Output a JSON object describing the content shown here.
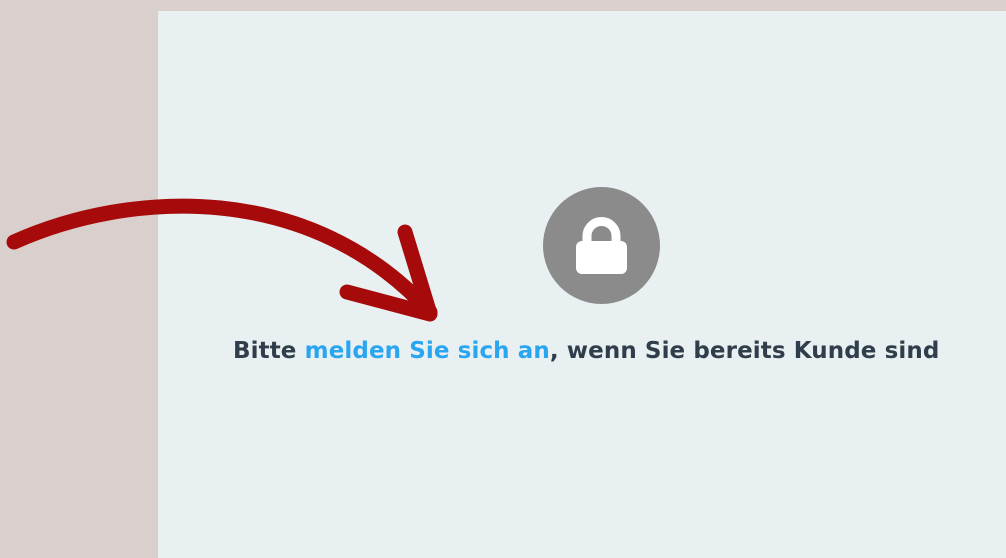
{
  "notice": {
    "prefix": "Bitte ",
    "link_text": "melden Sie sich an",
    "suffix": ", wenn Sie bereits Kunde sind"
  },
  "icons": {
    "lock": "lock-icon",
    "arrow": "curved-arrow-icon"
  },
  "colors": {
    "background": "#d9cfcc",
    "panel": "#e8f0f2",
    "lock_circle": "#8b8b8b",
    "text": "#2f3e4a",
    "link": "#2aa5f0",
    "arrow": "#a70a0a"
  }
}
